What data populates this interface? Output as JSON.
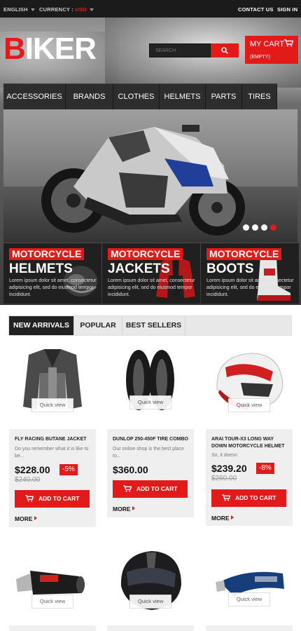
{
  "topbar": {
    "language": "ENGLISH",
    "currency_label": "CURRENCY :",
    "currency_value": "USD",
    "contact_us": "CONTACT US",
    "sign_in": "SIGN IN"
  },
  "header": {
    "logo_first": "B",
    "logo_rest": "IKER",
    "search_placeholder": "SEARCH",
    "cart_label": "MY CART",
    "cart_status": "(EMPTY)"
  },
  "nav": {
    "items": [
      "ACCESSORIES",
      "BRANDS",
      "CLOTHES",
      "HELMETS",
      "PARTS",
      "TIRES"
    ]
  },
  "slider": {
    "dots": 4,
    "active_dot": 4
  },
  "banners": [
    {
      "tag": "MOTORCYCLE",
      "title": "HELMETS",
      "text": "Lorem ipsum dolor sit amet, consectetur adipisicing elit, sed do eiusmod tempor incididunt."
    },
    {
      "tag": "MOTORCYCLE",
      "title": "JACKETS",
      "text": "Lorem ipsum dolor sit amet, consectetur adipisicing elit, sed do eiusmod tempor incididunt."
    },
    {
      "tag": "MOTORCYCLE",
      "title": "BOOTS",
      "text": "Lorem ipsum dolor sit amet, consectetur adipisicing elit, sed do eiusmod tempor incididunt."
    }
  ],
  "tabs": [
    "NEW ARRIVALS",
    "POPULAR",
    "BEST SELLERS"
  ],
  "quick_view": "Quick view",
  "add_to_cart": "ADD TO CART",
  "more": "MORE",
  "products": [
    {
      "name": "FLY RACING BUTANE JACKET",
      "desc": "Do you remember what it is like to be...",
      "price": "$228.00",
      "old_price": "$240.00",
      "discount": "-5%"
    },
    {
      "name": "DUNLOP 250-450F TIRE COMBO",
      "desc": "Our online shop is the best place to...",
      "price": "$360.00",
      "old_price": "",
      "discount": ""
    },
    {
      "name": "ARAI TOUR-X3 LONG WAY DOWN MOTORCYCLE HELMET",
      "desc": "So, it doesn",
      "price": "$239.20",
      "old_price": "$260.00",
      "discount": "-8%"
    }
  ],
  "colors": {
    "accent": "#e21a1a",
    "dark": "#222222",
    "nav": "#2d2d2d"
  }
}
